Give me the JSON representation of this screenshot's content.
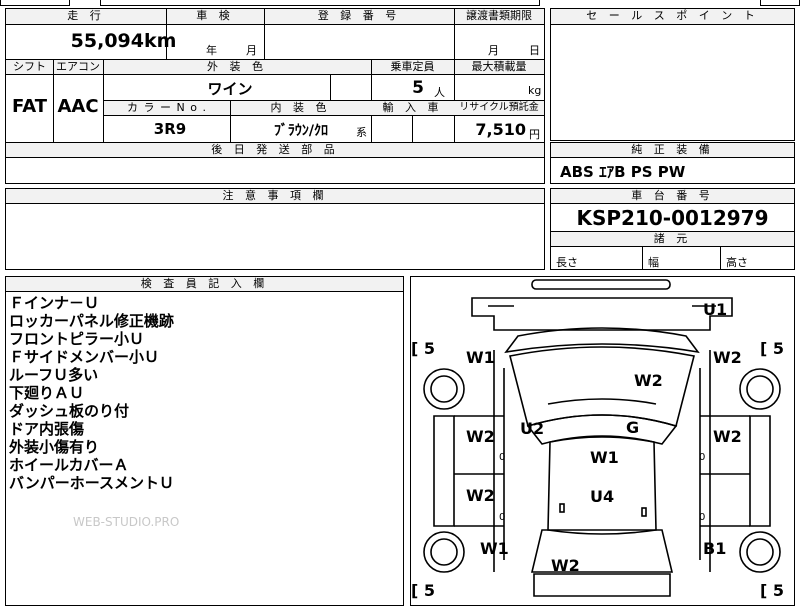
{
  "top": {
    "hdr_mileage": "走 行",
    "hdr_inspection": "車 検",
    "hdr_registration": "登 録 番 号",
    "hdr_transfer_deadline": "譲渡書類期限",
    "mileage_value": "55,094",
    "mileage_unit": "km",
    "inspection_year": "年",
    "inspection_month": "月",
    "transfer_month": "月",
    "transfer_day": "日"
  },
  "spec": {
    "hdr_shift": "シフト",
    "hdr_aircon": "エアコン",
    "hdr_exterior_color": "外 装 色",
    "hdr_capacity": "乗車定員",
    "hdr_max_load": "最大積載量",
    "shift": "FAT",
    "aircon": "AAC",
    "exterior_color": "ワイン",
    "capacity": "5",
    "capacity_unit": "人",
    "load_unit": "kg",
    "hdr_color_no": "カ ラ ー N o .",
    "hdr_interior": "内 装 色",
    "hdr_import": "輸 入 車",
    "hdr_recycle": "リサイクル預託金",
    "color_no": "3R9",
    "interior": "ﾌﾞﾗｳﾝ/ｸﾛ",
    "interior_suffix": "系",
    "recycle": "7,510",
    "recycle_unit": "円",
    "hdr_parts_later": "後 日 発 送 部 品"
  },
  "sales_point": {
    "hdr": "セ ー ル ス ポ イ ン ト"
  },
  "equipment": {
    "hdr": "純 正 装 備",
    "value": "ABS ｴｱB PS PW"
  },
  "notes": {
    "hdr": "注 意 事 項 欄"
  },
  "chassis": {
    "hdr": "車 台 番 号",
    "value": "KSP210-0012979",
    "hdr_dims": "諸 元",
    "length": "長さ",
    "width": "幅",
    "height": "高さ"
  },
  "inspector": {
    "hdr": "検 査 員 記 入 欄",
    "lines": [
      "Ｆインナ－Ｕ",
      "ロッカーパネル修正機跡",
      "フロントピラー小Ｕ",
      "Ｆサイドメンバー小Ｕ",
      "ルーフＵ多い",
      "下廻りＡＵ",
      "ダッシュ板のり付",
      "ドア内張傷",
      "外装小傷有り",
      "ホイールカバーＡ",
      "バンパーホースメントＵ"
    ],
    "watermark": "WEB-STUDIO.PRO"
  },
  "diagram": {
    "labels": {
      "u1": "U1",
      "w1_fl": "W1",
      "w2_fr": "W2",
      "w2_hood": "W2",
      "u2": "U2",
      "g": "G",
      "w2_door_fl": "W2",
      "w2_door_fr": "W2",
      "w1_roof": "W1",
      "u4": "U4",
      "w2_door_rl": "W2",
      "w1_rl": "W1",
      "b1_rr": "B1",
      "w2_trunk": "W2"
    },
    "tire_tl": "5",
    "tire_tr": "5",
    "tire_bl": "5",
    "tire_br": "5",
    "zero": "0"
  }
}
